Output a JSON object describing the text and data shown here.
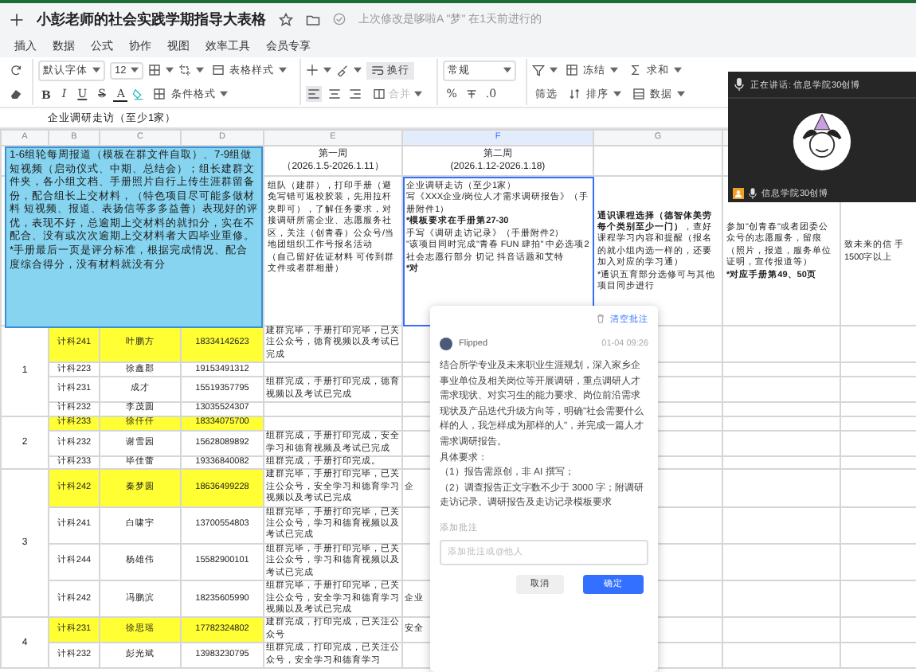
{
  "title_bar": {
    "title": "小彭老师的社会实践学期指导大表格",
    "status": "上次修改是哆啦A \"梦\" 在1天前进行的"
  },
  "menu": [
    "插入",
    "数据",
    "公式",
    "协作",
    "视图",
    "效率工具",
    "会员专享"
  ],
  "toolbar": {
    "font": "默认字体",
    "size": "12",
    "table_style": "表格样式",
    "wrap": {
      "label": "换行",
      "on": true
    },
    "number_format": "常规",
    "freeze": "冻结",
    "sum": "求和",
    "text_styles": [
      "B",
      "I",
      "U",
      "S",
      "A"
    ],
    "conditional": "条件格式",
    "align": [
      {
        "selected": true
      },
      {
        "selected": false
      },
      {
        "selected": false
      }
    ],
    "merge": {
      "label": "合并",
      "disabled": true
    },
    "percent": "%",
    "decimal": ".0",
    "filter": "筛选",
    "sort": "排序",
    "data": "数据"
  },
  "formula_bar": {
    "content": "企业调研走访（至少1家）"
  },
  "columns": [
    {
      "label": "A",
      "selected": false
    },
    {
      "label": "B",
      "selected": false
    },
    {
      "label": "C",
      "selected": false
    },
    {
      "label": "D",
      "selected": false
    },
    {
      "label": "E",
      "selected": false
    },
    {
      "label": "F",
      "selected": true
    },
    {
      "label": "G",
      "selected": false
    }
  ],
  "week_row": [
    {
      "week": "第一周",
      "dates": "（2026.1.5-2026.1.11）"
    },
    {
      "week": "第二周",
      "dates": "(2026.1.12-2026.1.18)"
    }
  ],
  "task_row": [
    {
      "selected": false,
      "paragraphs": [
        [
          {
            "text": "组队（建群），打印手册（避免写错可返校胶装，先用拉杆夹即可），了解任务要求，对接调研所需企业、志愿服务社区，关注（创青春）公众号/当地团组织工作号报名活动",
            "bold": false
          }
        ],
        [
          {
            "text": "（自己留好佐证材料 可传到群文件或者群相册）",
            "bold": false
          }
        ]
      ]
    },
    {
      "selected": true,
      "paragraphs": [
        [
          {
            "text": "企业调研走访（至少1家）",
            "bold": false
          }
        ],
        [
          {
            "text": "写《XXX企业/岗位人才需求调研报告》（手册附件1）",
            "bold": false
          }
        ],
        [
          {
            "text": "*模板要求在手册第27-30",
            "bold": true
          }
        ],
        [
          {
            "text": "手写《调研走访记录》（手册附件2）",
            "bold": false
          }
        ],
        [
          {
            "text": "\"该项目同时完成\"青春 FUN 肆拍\" 中必选项2 社会志愿行部分 切记 抖音话题和艾特",
            "bold": false
          }
        ],
        [
          {
            "text": "*对",
            "bold": true
          }
        ]
      ]
    },
    {
      "selected": false,
      "paragraphs": [
        [
          {
            "text": "通识课程选择（德智体美劳每个类别至少一门）",
            "bold": true
          },
          {
            "text": "，查好课程学习内容和提醒（报名的就小组内选一样的，还要加入对应的学习通）",
            "bold": false
          }
        ],
        [
          {
            "text": "*通识五育部分选修可与其他项目同步进行",
            "bold": false
          }
        ]
      ]
    },
    {
      "selected": false,
      "paragraphs": [
        [
          {
            "text": "参加\"创青春\"或者团委公众号的志愿服务，留痕（照片，报道，服务单位证明，宣传报道等）",
            "bold": false
          }
        ],
        [
          {
            "text": "*对应手册第49、50页",
            "bold": true
          }
        ]
      ]
    },
    {
      "selected": false,
      "paragraphs": [
        [
          {
            "text": "致未来的信 手1500字以上",
            "bold": false
          }
        ]
      ]
    }
  ],
  "note": {
    "text": "1-6组轮每周报道（模板在群文件自取）、7-9组做短视频（启动仪式、中期、总结会）；组长建群文件夹，各小组文档、手册照片自行上传生涯群留备份，配合组长上交材料，（特色项目尽可能多做材料 短视频、报道、表扬信等多多益善）表现好的评优，表现不好，总逾期上交材料的就扣分，实在不配合、没有或次次逾期上交材料者大四毕业重修。\n*手册最后一页是评分标准，根据完成情况、配合度综合得分，没有材料就没有分"
  },
  "groups": [
    {
      "number": "1",
      "rows": [
        {
          "class_name": "计科241",
          "student": "叶鹏方",
          "phone": "18334142623",
          "highlighted": true,
          "week1": "建群完毕，手册打印完毕，已关注公众号，德育视频以及考试已完成"
        },
        {
          "class_name": "计科223",
          "student": "徐鑫郡",
          "phone": "19153491312",
          "highlighted": false
        },
        {
          "class_name": "计科231",
          "student": "成才",
          "phone": "15519357795",
          "highlighted": false,
          "week1": "组群完成，手册打印完成，德育视频以及考试已完成"
        },
        {
          "class_name": "计科232",
          "student": "李茂圆",
          "phone": "13035524307",
          "highlighted": false
        }
      ]
    },
    {
      "number": "2",
      "rows": [
        {
          "class_name": "计科233",
          "student": "徐仟仟",
          "phone": "18334075700",
          "highlighted": true
        },
        {
          "class_name": "计科232",
          "student": "谢雪园",
          "phone": "15628089892",
          "highlighted": false,
          "week1": "组群完成，手册打印完成，安全学习和德育视频及考试已完成"
        },
        {
          "class_name": "计科233",
          "student": "毕佳蕾",
          "phone": "19336840082",
          "highlighted": false,
          "week1": "组群完成，手册打印完成。"
        }
      ]
    },
    {
      "number": "3",
      "rows": [
        {
          "class_name": "计科242",
          "student": "秦梦圆",
          "phone": "18636499228",
          "highlighted": true,
          "week1": "建群完毕，手册打印完毕，已关注公众号，安全学习和德育学习视频以及考试已完成",
          "week2": "企"
        },
        {
          "class_name": "计科241",
          "student": "白啸宇",
          "phone": "13700554803",
          "highlighted": false,
          "week1": "组群完毕，手册打印完毕，已关注公众号，学习和德育视频以及考试已完成"
        },
        {
          "class_name": "计科244",
          "student": "杨雄伟",
          "phone": "15582900101",
          "highlighted": false,
          "week1": "组群完毕，手册打印完毕，已关注公众号，学习和德育视频以及考试已完成"
        },
        {
          "class_name": "计科242",
          "student": "冯鹏滨",
          "phone": "18235605990",
          "highlighted": false,
          "week1": "组群完毕，手册打印完毕，已关注公众号，安全学习和德育学习视频以及考试已完成",
          "week2": "企业"
        }
      ]
    },
    {
      "number": "4",
      "rows": [
        {
          "class_name": "计科231",
          "student": "徐思瑶",
          "phone": "17782324802",
          "highlighted": true,
          "week1": "建群完成，打印完成，已关注公众号",
          "week2": "安全"
        },
        {
          "class_name": "计科232",
          "student": "彭光斌",
          "phone": "13983230795",
          "highlighted": false,
          "week1": "组群完成，打印完成，已关注公众号，安全学习和德育学习"
        }
      ]
    }
  ],
  "comment": {
    "clear": "清空批注",
    "author": "Flipped",
    "time": "01-04 09:26",
    "body": [
      "结合所学专业及未来职业生涯规划，深入家乡企事业单位及相关岗位等开展调研，重点调研人才需求现状、对实习生的能力要求、岗位前沿需求现状及产品迭代升级方向等，明确\"社会需要什么样的人，我怎样成为那样的人\"，并完成一篇人才需求调研报告。",
      "具体要求：",
      "（1）报告需原创，非 AI 撰写；",
      "（2）调查报告正文字数不少于 3000 字；附调研走访记录。调研报告及走访记录模板要求"
    ],
    "add_label": "添加批注",
    "placeholder": "添加批注或@他人",
    "cancel": "取消",
    "confirm": "确定"
  },
  "video": {
    "speaking": "正在讲话: 信息学院30创博",
    "name": "信息学院30创博"
  }
}
